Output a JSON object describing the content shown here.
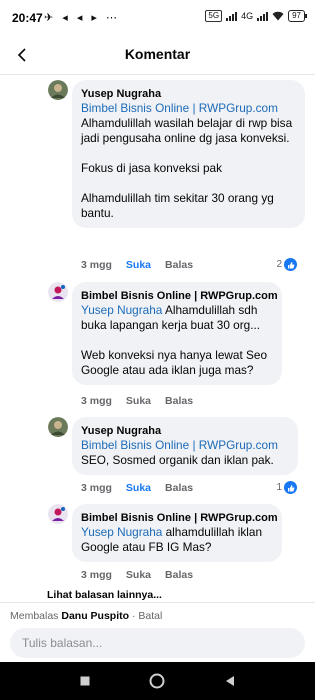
{
  "status_bar": {
    "time": "20:47",
    "left_icons": "✈ ◂ ◂ ▸ ⋯",
    "sim_label": "4G",
    "battery": "97"
  },
  "header": {
    "title": "Komentar"
  },
  "comments": [
    {
      "author": "Yusep Nugraha",
      "mention": "Bimbel Bisnis Online | RWPGrup.com",
      "text1": "Alhamdulillah wasilah belajar di rwp bisa jadi pengusaha online dg jasa konveksi.",
      "text2": "Fokus di jasa konveksi pak",
      "text3": "Alhamdulillah tim sekitar 30 orang yg bantu.",
      "time": "3 mgg",
      "like": "Suka",
      "reply": "Balas",
      "reactions": "2"
    },
    {
      "author": "Bimbel Bisnis Online | RWPGrup.com",
      "mention": "Yusep Nugraha",
      "text1": " Alhamdulillah sdh buka lapangan kerja buat 30 org...",
      "text2": "Web konveksi nya hanya lewat Seo Google atau ada iklan juga mas?",
      "time": "3 mgg",
      "like": "Suka",
      "reply": "Balas"
    },
    {
      "author": "Yusep Nugraha",
      "mention": "Bimbel Bisnis Online | RWPGrup.com",
      "text1": "SEO, Sosmed organik dan iklan pak.",
      "time": "3 mgg",
      "like": "Suka",
      "reply": "Balas",
      "reactions": "1"
    },
    {
      "author": "Bimbel Bisnis Online | RWPGrup.com",
      "mention": "Yusep Nugraha",
      "text1": " alhamdulillah iklan Google atau FB IG Mas?",
      "time": "3 mgg",
      "like": "Suka",
      "reply": "Balas"
    }
  ],
  "more_replies": "Lihat balasan lainnya...",
  "reply_bar": {
    "prefix": "Membalas ",
    "name": "Danu Puspito",
    "separator": " · ",
    "cancel": "Batal",
    "placeholder": "Tulis balasan..."
  },
  "colors": {
    "mention": "#1d6bb8",
    "like_active": "#1877f2",
    "bubble": "#f0f2f5"
  }
}
